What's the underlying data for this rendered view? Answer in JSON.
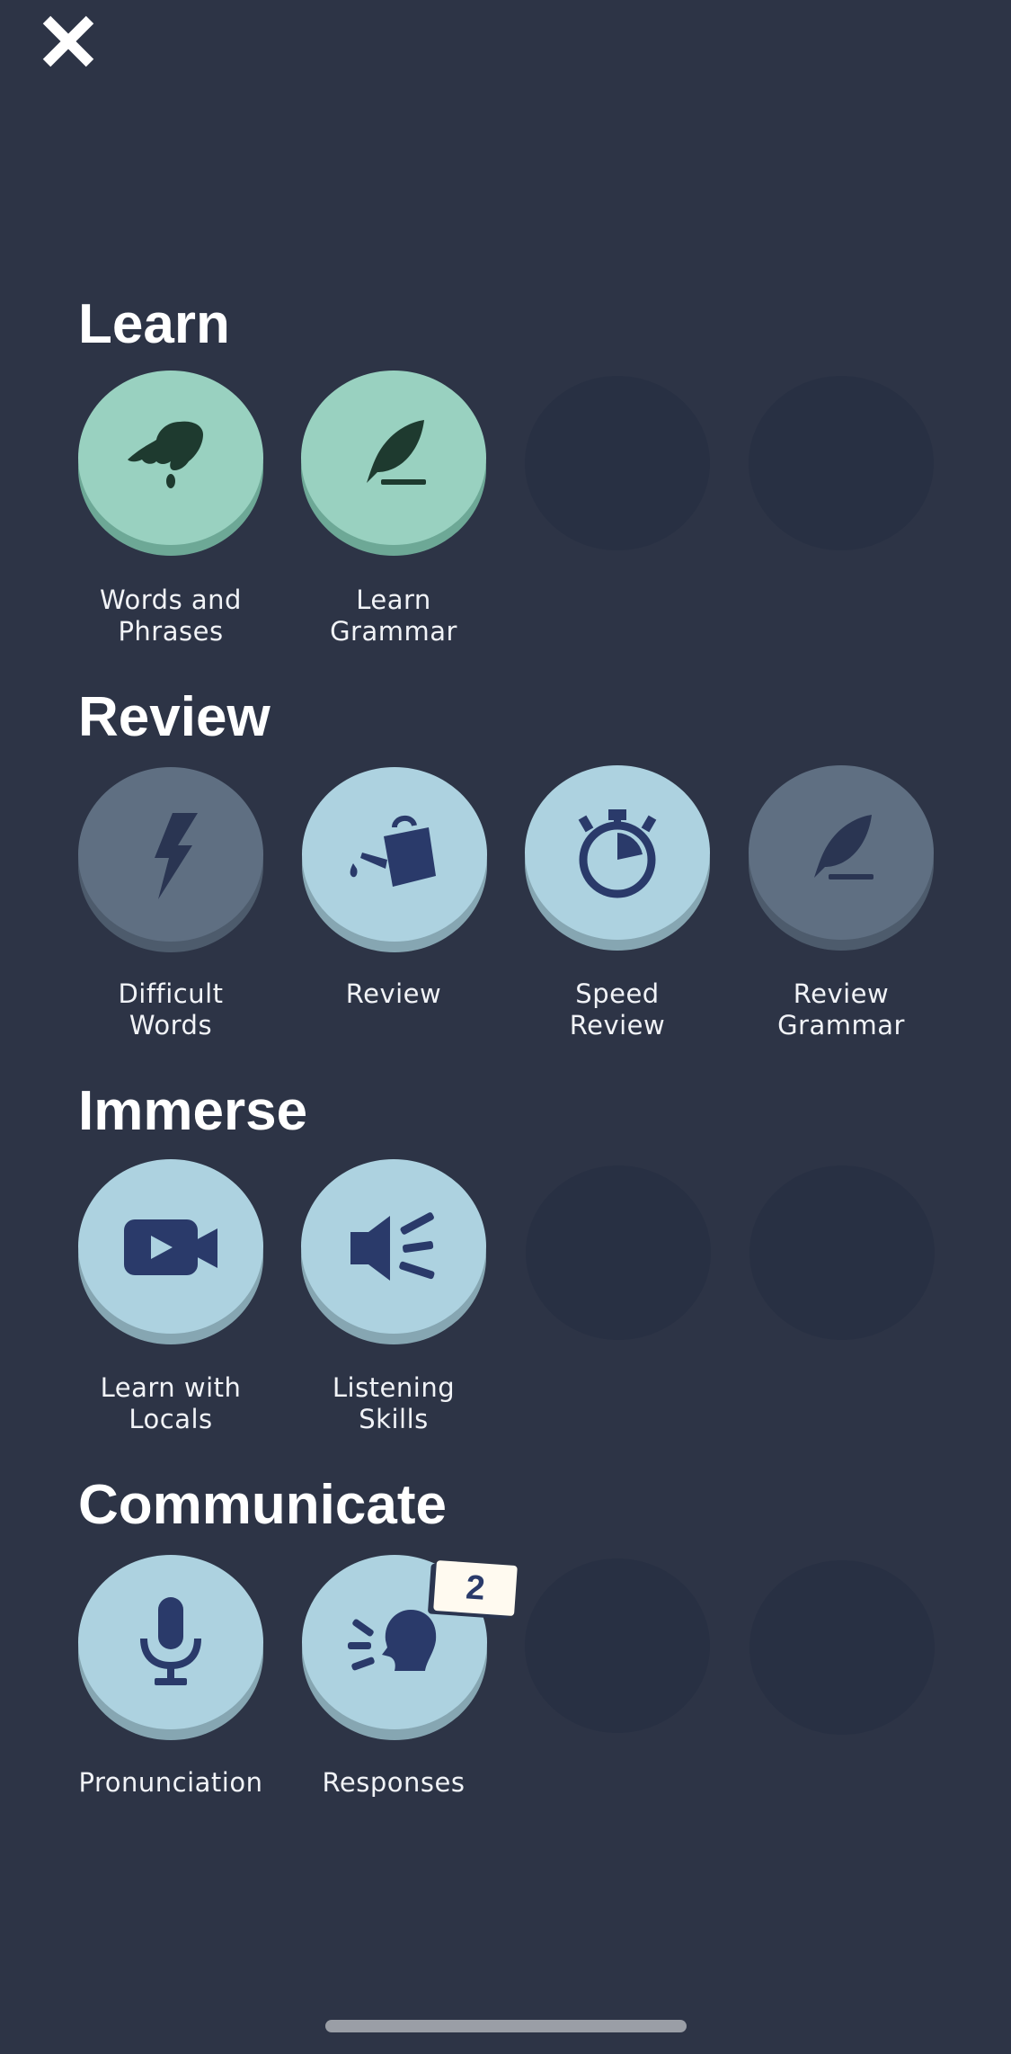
{
  "close_button": {
    "icon": "close-icon",
    "color": "#ffffff"
  },
  "colors": {
    "background": "#2d3446",
    "learn_tile": "#99d1c0",
    "blue_tile": "#add2e0",
    "locked_tile": "#5f6f82",
    "icon_dark": "#2a3a6a"
  },
  "sections": [
    {
      "title": "Learn",
      "items": [
        {
          "label": "Words and\nPhrases",
          "icon": "hand-pinch-icon"
        },
        {
          "label": "Learn\nGrammar",
          "icon": "quill-icon"
        }
      ]
    },
    {
      "title": "Review",
      "items": [
        {
          "label": "Difficult\nWords",
          "icon": "lightning-icon"
        },
        {
          "label": "Review",
          "icon": "watering-can-icon"
        },
        {
          "label": "Speed\nReview",
          "icon": "stopwatch-icon"
        },
        {
          "label": "Review\nGrammar",
          "icon": "quill-icon"
        }
      ]
    },
    {
      "title": "Immerse",
      "items": [
        {
          "label": "Learn with\nLocals",
          "icon": "video-camera-icon"
        },
        {
          "label": "Listening\nSkills",
          "icon": "speaker-icon"
        }
      ]
    },
    {
      "title": "Communicate",
      "items": [
        {
          "label": "Pronunciation",
          "icon": "microphone-icon"
        },
        {
          "label": "Responses",
          "icon": "speaking-head-icon",
          "badge": "2"
        }
      ]
    }
  ]
}
